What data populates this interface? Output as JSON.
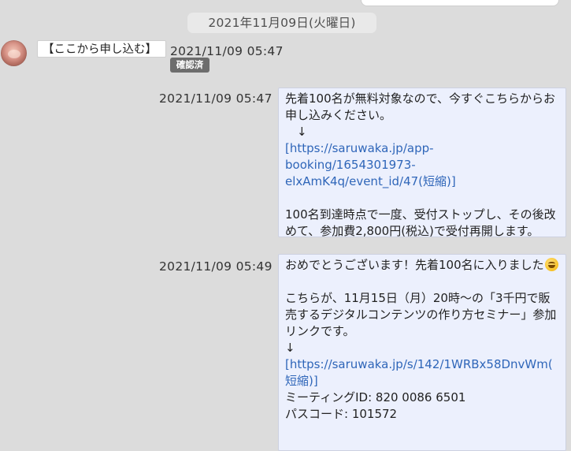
{
  "date_separator": "2021年11月09日(火曜日)",
  "messages": [
    {
      "direction": "incoming",
      "text": "【ここから申し込む】",
      "time": "2021/11/09 05:47",
      "status": "確認済"
    },
    {
      "direction": "outgoing",
      "time": "2021/11/09 05:47",
      "lines": [
        "先着100名が無料対象なので、今すぐこちらからお",
        "申し込みください。",
        "　↓",
        "[https://saruwaka.jp/app-",
        "booking/1654301973-",
        "elxAmK4q/event_id/47(短縮)]",
        "",
        "100名到達時点で一度、受付ストップし、その後改",
        "めて、参加費2,800円(税込)で受付再開します。"
      ]
    },
    {
      "direction": "outgoing",
      "time": "2021/11/09 05:49",
      "lines": [
        "おめでとうございます！先着100名に入りました",
        "",
        "こちらが、11月15日（月）20時〜の「3千円で販",
        "売するデジタルコンテンツの作り方セミナー」参加",
        "リンクです。",
        "↓",
        "[https://saruwaka.jp/s/142/1WRBx58DnvWm(",
        "短縮)]",
        "ミーティングID: 820 0086 6501",
        "パスコード: 101572"
      ],
      "emoji": "grinning-face-emoji"
    }
  ]
}
